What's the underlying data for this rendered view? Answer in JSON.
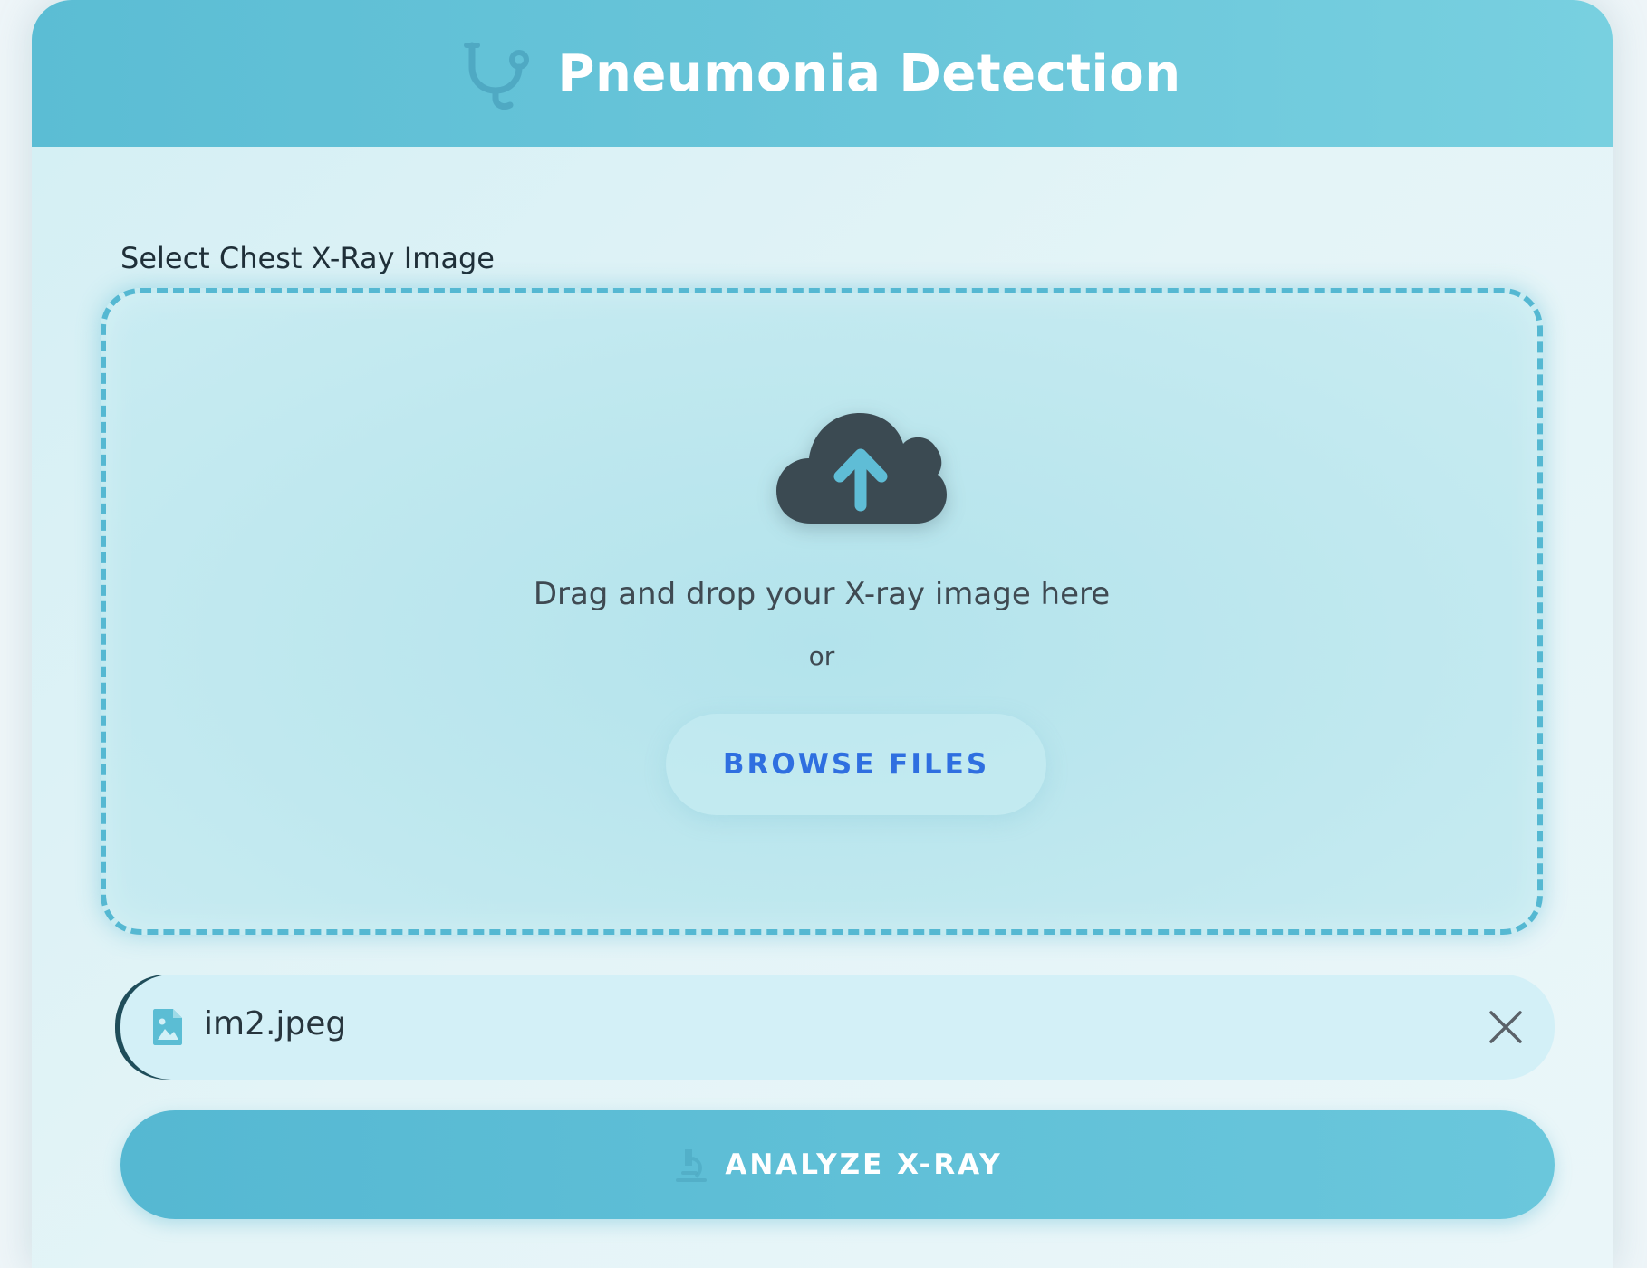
{
  "header": {
    "title": "Pneumonia Detection",
    "icon": "stethoscope-icon"
  },
  "upload": {
    "label": "Select Chest X-Ray Image",
    "icon": "cloud-upload-icon",
    "drop_text": "Drag and drop your X-ray image here",
    "or_text": "or",
    "browse_label": "BROWSE FILES"
  },
  "selected_file": {
    "icon": "image-file-icon",
    "name": "im2.jpeg",
    "remove_icon": "close-icon"
  },
  "analyze": {
    "icon": "microscope-icon",
    "label": "ANALYZE X-RAY"
  },
  "colors": {
    "accent": "#55b8d2",
    "browse_text": "#2f6fe0",
    "cloud": "#3b4a52"
  }
}
